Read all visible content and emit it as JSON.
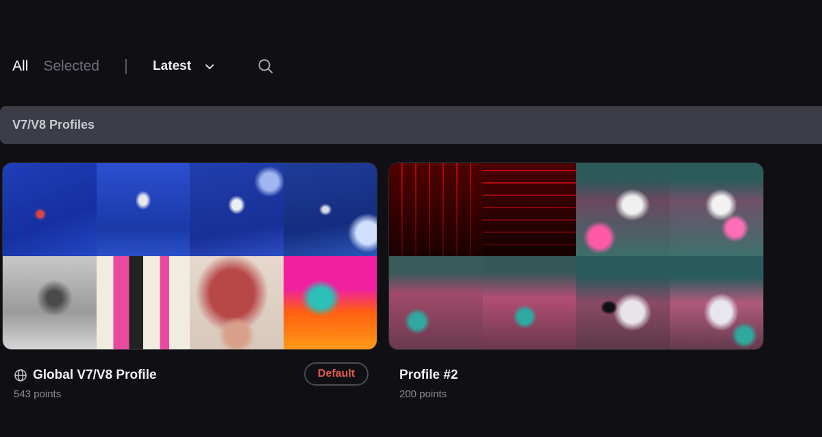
{
  "filters": {
    "all_label": "All",
    "selected_label": "Selected",
    "sort_label": "Latest"
  },
  "icons": {
    "sort": "chevron-down-icon",
    "search": "search-icon",
    "globe": "globe-icon"
  },
  "section": {
    "title": "V7/V8 Profiles"
  },
  "profiles": [
    {
      "title": "Global V7/V8 Profile",
      "points": "543 points",
      "badge": "Default",
      "global": true
    },
    {
      "title": "Profile #2",
      "points": "200 points",
      "badge": "",
      "global": false
    }
  ],
  "colors": {
    "background": "#0f0f14",
    "section_bg": "#3c3d47",
    "badge_text": "#e05a4e",
    "muted_text": "#8b8c95"
  }
}
